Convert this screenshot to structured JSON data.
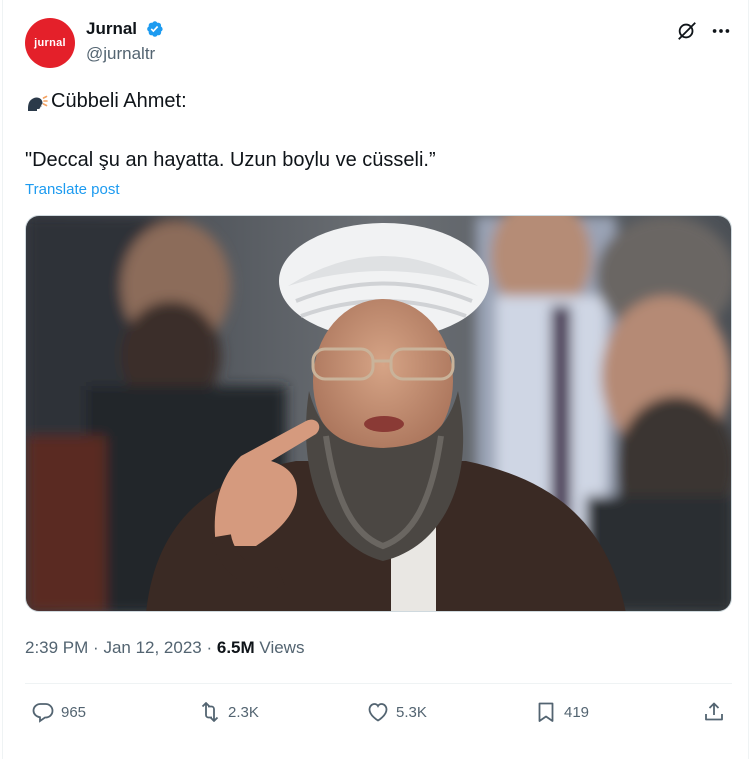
{
  "author": {
    "avatar_text": "jurnal",
    "name": "Jurnal",
    "handle": "@jurnaltr",
    "verified": true
  },
  "header_icons": [
    "grok-icon",
    "more-icon"
  ],
  "post": {
    "line1": "Cübbeli Ahmet:",
    "line2": "\"Deccal şu an hayatta. Uzun boylu ve cüsseli.”",
    "translate_label": "Translate post"
  },
  "meta": {
    "time": "2:39 PM",
    "date": "Jan 12, 2023",
    "views_count": "6.5M",
    "views_label": "Views"
  },
  "actions": {
    "replies": "965",
    "reposts": "2.3K",
    "likes": "5.3K",
    "bookmarks": "419"
  },
  "colors": {
    "accent": "#1d9bf0",
    "brand_avatar": "#e4202a",
    "secondary_text": "#536471"
  }
}
